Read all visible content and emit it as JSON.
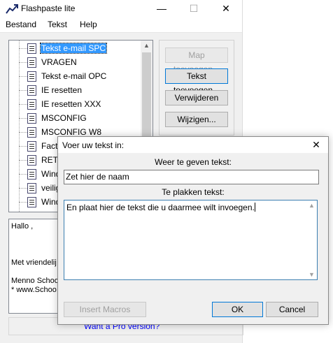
{
  "window": {
    "title": "Flashpaste lite",
    "minimize": "—",
    "maximize": "☐",
    "close": "✕"
  },
  "menu": [
    "Bestand",
    "Tekst",
    "Help"
  ],
  "tree": {
    "items": [
      {
        "label": "Tekst e-mail SPC",
        "selected": true
      },
      {
        "label": "VRAGEN"
      },
      {
        "label": "Tekst e-mail OPC"
      },
      {
        "label": "IE resetten"
      },
      {
        "label": "IE resetten XXX"
      },
      {
        "label": "MSCONFIG"
      },
      {
        "label": "MSCONFIG W8"
      },
      {
        "label": "Fact"
      },
      {
        "label": "RET"
      },
      {
        "label": "Wind"
      },
      {
        "label": "veilig"
      },
      {
        "label": "Wind"
      }
    ]
  },
  "buttons": {
    "map_add": "Map toevoegen...",
    "text_add": "Tekst toevoegen...",
    "delete": "Verwijderen",
    "edit": "Wijzigen..."
  },
  "preview": {
    "lines": [
      "Hallo ,",
      "",
      "",
      "Met vriendelij",
      "",
      "Menno Schoo",
      "* www.Schoo"
    ]
  },
  "status": {
    "link": "Want a Pro version?"
  },
  "dialog": {
    "title": "Voer uw tekst in:",
    "close": "✕",
    "name_label": "Weer te geven tekst:",
    "name_value": "Zet hier de naam",
    "paste_label": "Te plakken tekst:",
    "paste_value": "En plaat hier de tekst die u daarmee wilt invoegen.",
    "insert_macros": "Insert Macros",
    "ok": "OK",
    "cancel": "Cancel"
  }
}
